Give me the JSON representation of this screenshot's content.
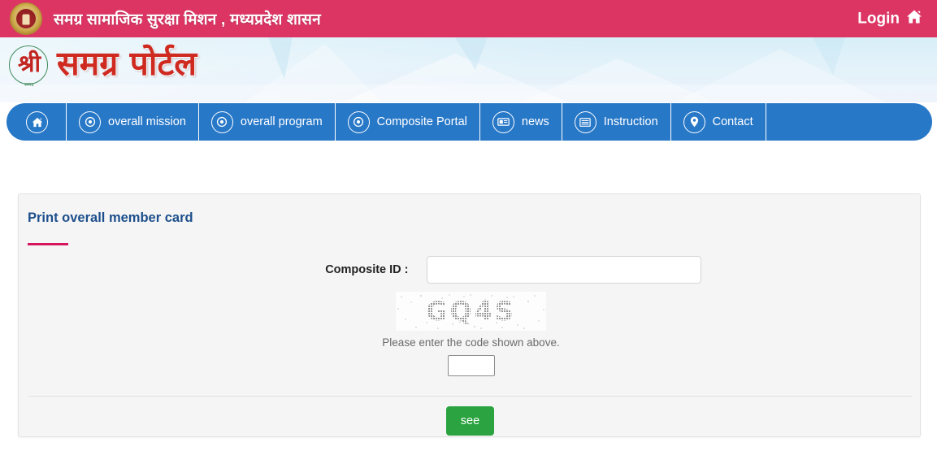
{
  "topbar": {
    "emblem_icon": "mp-government-emblem-icon",
    "title": "समग्र सामाजिक सुरक्षा मिशन , मध्यप्रदेश शासन",
    "login_label": "Login",
    "home_icon": "home-icon",
    "bg_color": "#dc3564"
  },
  "banner": {
    "logo_mark_char": "श्री",
    "logo_mark_sub": "समग्र",
    "logo_text": "समग्र पोर्टल",
    "logo_color": "#cf2a20"
  },
  "nav": {
    "bg_color": "#2878c8",
    "items": [
      {
        "label": "",
        "icon": "home-icon",
        "is_home": true
      },
      {
        "label": "overall mission",
        "icon": "target-circle-icon",
        "is_home": false
      },
      {
        "label": "overall program",
        "icon": "target-circle-icon",
        "is_home": false
      },
      {
        "label": "Composite Portal",
        "icon": "target-circle-icon",
        "is_home": false
      },
      {
        "label": "news",
        "icon": "newspaper-icon",
        "is_home": false
      },
      {
        "label": "Instruction",
        "icon": "list-lines-icon",
        "is_home": false
      },
      {
        "label": "Contact",
        "icon": "location-pin-icon",
        "is_home": false
      }
    ]
  },
  "panel": {
    "title": "Print overall member card",
    "title_color": "#1d4f8c",
    "underline_color": "#d5165c",
    "form": {
      "composite_id_label": "Composite ID :",
      "composite_id_value": "",
      "composite_id_placeholder": ""
    },
    "captcha": {
      "code_text": "GQ4S",
      "hint": "Please enter the code shown above.",
      "input_value": "",
      "input_placeholder": ""
    },
    "submit_label": "see",
    "submit_color": "#2aa340"
  }
}
